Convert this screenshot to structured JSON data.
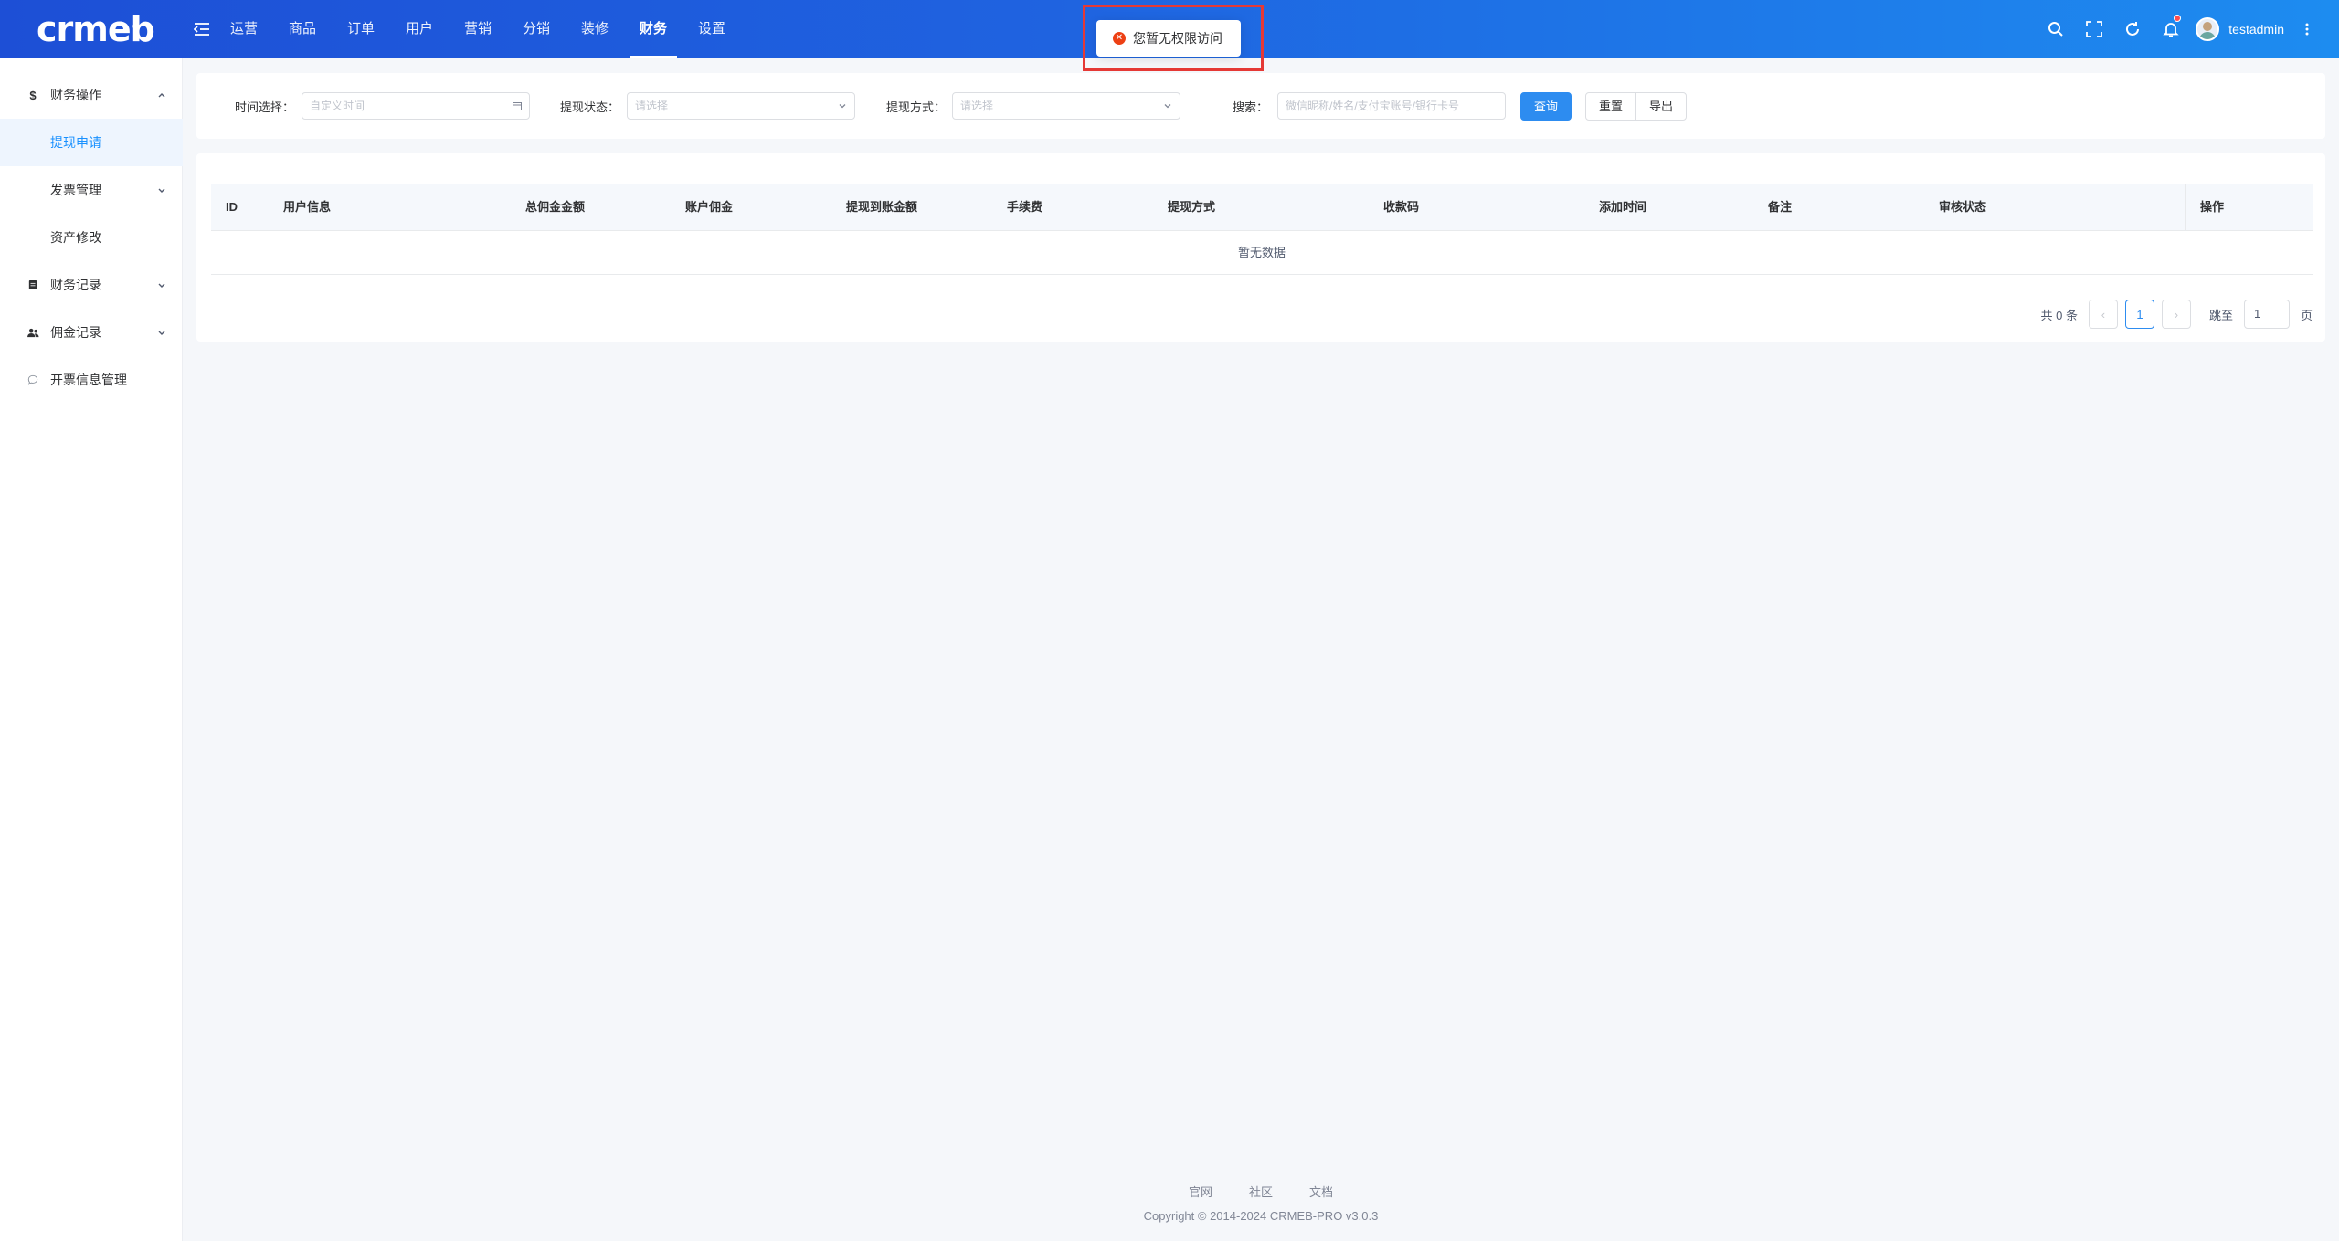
{
  "brand": {
    "logo_text": "crmeb",
    "logo_mark": "®"
  },
  "top_nav": [
    "运营",
    "商品",
    "订单",
    "用户",
    "营销",
    "分销",
    "装修",
    "财务",
    "设置"
  ],
  "active_nav": "财务",
  "header": {
    "username": "testadmin",
    "accent_color": "#1f63e0"
  },
  "toast": {
    "message": "您暂无权限访问",
    "icon": "error-circle-icon"
  },
  "sidebar": {
    "finance_ops": "财务操作",
    "withdraw_apply": "提现申请",
    "invoice_mgmt": "发票管理",
    "asset_edit": "资产修改",
    "finance_records": "财务记录",
    "commission_records": "佣金记录",
    "invoice_info": "开票信息管理"
  },
  "filters": {
    "time_label": "时间选择：",
    "time_placeholder": "自定义时间",
    "status_label": "提现状态：",
    "status_placeholder": "请选择",
    "method_label": "提现方式：",
    "method_placeholder": "请选择",
    "search_label": "搜索：",
    "search_placeholder": "微信昵称/姓名/支付宝账号/银行卡号",
    "query_btn": "查询",
    "reset_btn": "重置",
    "export_btn": "导出"
  },
  "table": {
    "columns": [
      "ID",
      "用户信息",
      "总佣金金额",
      "账户佣金",
      "提现到账金额",
      "手续费",
      "提现方式",
      "收款码",
      "添加时间",
      "备注",
      "审核状态",
      "操作"
    ],
    "empty_text": "暂无数据"
  },
  "pagination": {
    "total_text": "共 0 条",
    "current_page": "1",
    "jump_label": "跳至",
    "jump_value": "1",
    "page_suffix": "页"
  },
  "footer": {
    "links": [
      "官网",
      "社区",
      "文档"
    ],
    "copyright": "Copyright © 2014-2024 CRMEB-PRO v3.0.3"
  }
}
